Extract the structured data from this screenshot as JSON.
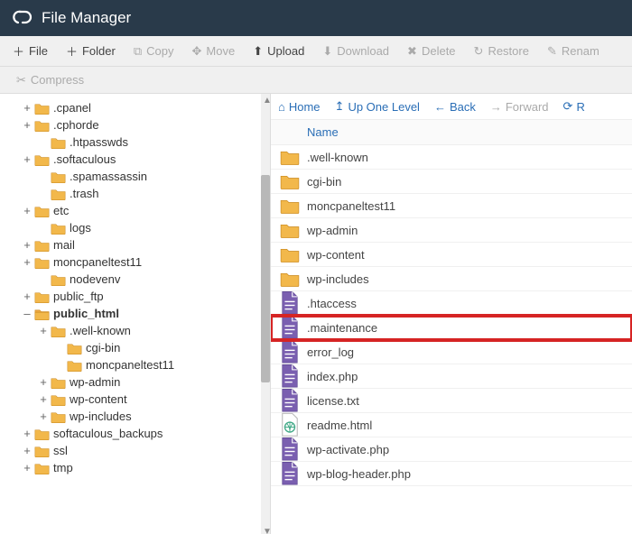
{
  "header": {
    "title": "File Manager"
  },
  "toolbar": {
    "file": "File",
    "folder": "Folder",
    "copy": "Copy",
    "move": "Move",
    "upload": "Upload",
    "download": "Download",
    "delete": "Delete",
    "restore": "Restore",
    "rename": "Renam",
    "compress": "Compress"
  },
  "nav": {
    "home": "Home",
    "up": "Up One Level",
    "back": "Back",
    "forward": "Forward",
    "reload": "R"
  },
  "columns": {
    "name": "Name"
  },
  "tree": [
    {
      "depth": 0,
      "toggle": "+",
      "label": ".cpanel"
    },
    {
      "depth": 0,
      "toggle": "+",
      "label": ".cphorde"
    },
    {
      "depth": 1,
      "toggle": "",
      "label": ".htpasswds"
    },
    {
      "depth": 0,
      "toggle": "+",
      "label": ".softaculous"
    },
    {
      "depth": 1,
      "toggle": "",
      "label": ".spamassassin"
    },
    {
      "depth": 1,
      "toggle": "",
      "label": ".trash"
    },
    {
      "depth": 0,
      "toggle": "+",
      "label": "etc"
    },
    {
      "depth": 1,
      "toggle": "",
      "label": "logs"
    },
    {
      "depth": 0,
      "toggle": "+",
      "label": "mail"
    },
    {
      "depth": 0,
      "toggle": "+",
      "label": "moncpaneltest11"
    },
    {
      "depth": 1,
      "toggle": "",
      "label": "nodevenv"
    },
    {
      "depth": 0,
      "toggle": "+",
      "label": "public_ftp"
    },
    {
      "depth": 0,
      "toggle": "–",
      "label": "public_html",
      "bold": true,
      "open": true
    },
    {
      "depth": 1,
      "toggle": "+",
      "label": ".well-known"
    },
    {
      "depth": 2,
      "toggle": "",
      "label": "cgi-bin"
    },
    {
      "depth": 2,
      "toggle": "",
      "label": "moncpaneltest11"
    },
    {
      "depth": 1,
      "toggle": "+",
      "label": "wp-admin"
    },
    {
      "depth": 1,
      "toggle": "+",
      "label": "wp-content"
    },
    {
      "depth": 1,
      "toggle": "+",
      "label": "wp-includes"
    },
    {
      "depth": 0,
      "toggle": "+",
      "label": "softaculous_backups"
    },
    {
      "depth": 0,
      "toggle": "+",
      "label": "ssl"
    },
    {
      "depth": 0,
      "toggle": "+",
      "label": "tmp"
    }
  ],
  "files": [
    {
      "type": "folder",
      "name": ".well-known"
    },
    {
      "type": "folder",
      "name": "cgi-bin"
    },
    {
      "type": "folder",
      "name": "moncpaneltest11"
    },
    {
      "type": "folder",
      "name": "wp-admin"
    },
    {
      "type": "folder",
      "name": "wp-content"
    },
    {
      "type": "folder",
      "name": "wp-includes"
    },
    {
      "type": "file",
      "name": ".htaccess"
    },
    {
      "type": "file",
      "name": ".maintenance",
      "highlighted": true
    },
    {
      "type": "file",
      "name": "error_log"
    },
    {
      "type": "file",
      "name": "index.php"
    },
    {
      "type": "file",
      "name": "license.txt"
    },
    {
      "type": "html",
      "name": "readme.html"
    },
    {
      "type": "file",
      "name": "wp-activate.php"
    },
    {
      "type": "file",
      "name": "wp-blog-header.php"
    }
  ]
}
